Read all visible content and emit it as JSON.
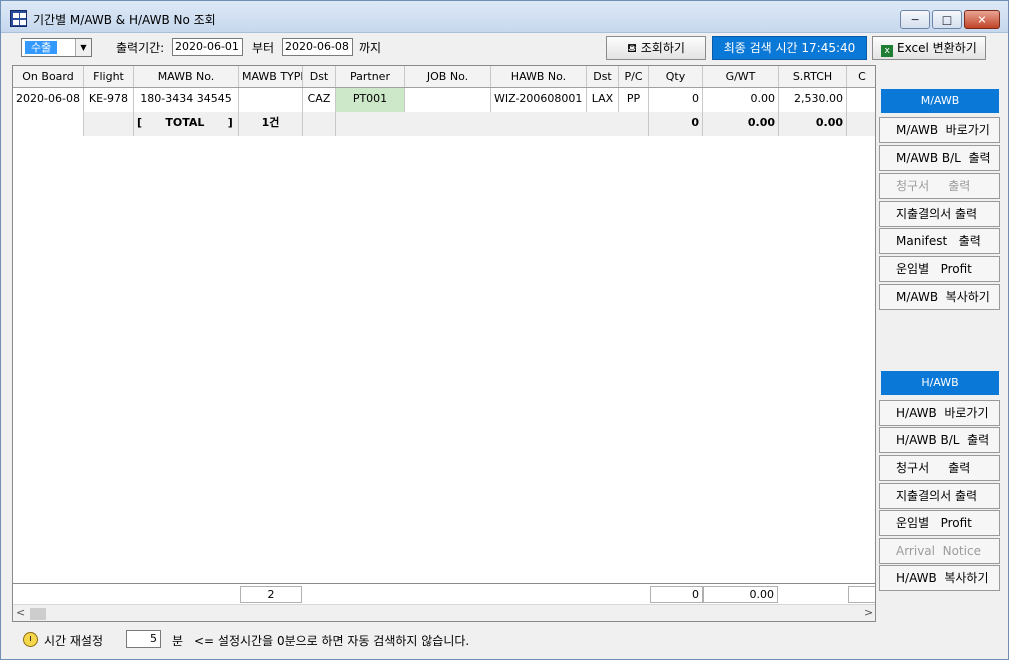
{
  "window": {
    "title": "기간별 M/AWB & H/AWB No 조회",
    "minimize": "─",
    "maximize": "□",
    "close": "✕"
  },
  "toolbar": {
    "mode_value": "수출",
    "period_label": "출력기간:",
    "date_from": "2020-06-01",
    "from_label": "부터",
    "date_to": "2020-06-08",
    "to_label": "까지",
    "search_button": "조회하기",
    "last_search": "최종 검색 시간 17:45:40",
    "excel_button": "Excel 변환하기"
  },
  "grid": {
    "columns": [
      "On Board",
      "Flight",
      "MAWB No.",
      "MAWB TYPE",
      "Dst",
      "Partner",
      "JOB No.",
      "HAWB No.",
      "Dst",
      "P/C",
      "Qty",
      "G/WT",
      "S.RTCH",
      "C"
    ],
    "rows": [
      [
        "2020-06-08",
        "KE-978",
        "180-3434 34545",
        "",
        "CAZ",
        "PT001",
        "",
        "WIZ-200608001",
        "LAX",
        "PP",
        "0",
        "0.00",
        "2,530.00",
        ""
      ]
    ],
    "total": {
      "open": "[",
      "label": "TOTAL",
      "close": "]",
      "count": "1건",
      "qty": "0",
      "gwt": "0.00",
      "srtch": "0.00"
    },
    "summary": {
      "count": "2",
      "qty": "0",
      "gwt": "0.00"
    }
  },
  "side": {
    "mawb_header": "M/AWB",
    "mawb_buttons": [
      "M/AWB  바로가기",
      "M/AWB B/L  출력",
      "청구서     출력",
      "지출결의서 출력",
      "Manifest   출력",
      "운임별   Profit",
      "M/AWB  복사하기"
    ],
    "mawb_disabled": [
      false,
      false,
      true,
      false,
      false,
      false,
      false
    ],
    "hawb_header": "H/AWB",
    "hawb_buttons": [
      "H/AWB  바로가기",
      "H/AWB B/L  출력",
      "청구서     출력",
      "지출결의서 출력",
      "운임별   Profit",
      "Arrival  Notice",
      "H/AWB  복사하기"
    ],
    "hawb_disabled": [
      false,
      false,
      false,
      false,
      false,
      true,
      false
    ]
  },
  "status": {
    "reset_label": "시간 재설정",
    "minutes": "5",
    "unit": "분",
    "note": "<= 설정시간을 0분으로 하면 자동 검색하지 않습니다."
  },
  "colors": {
    "accent": "#0a78d7",
    "partner_cell": "#cde8c8"
  }
}
